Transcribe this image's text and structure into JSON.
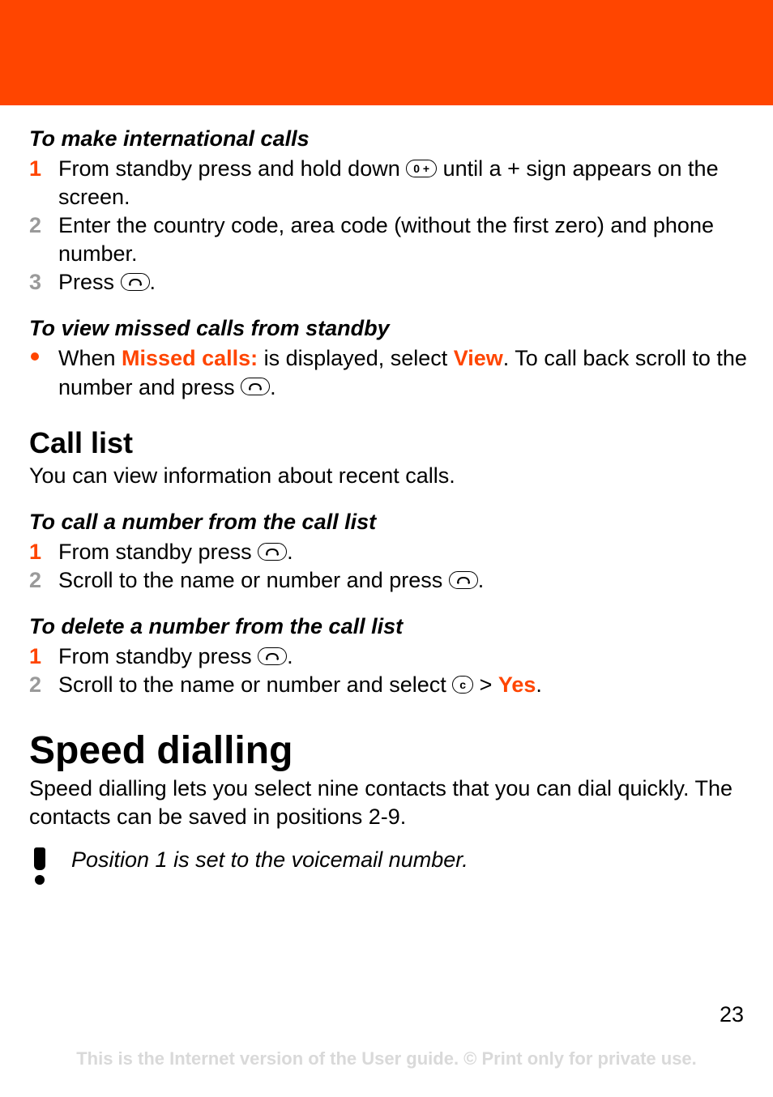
{
  "section1": {
    "heading": "To make international calls",
    "steps": [
      {
        "n": "1",
        "pre": "From standby press and hold down ",
        "post": " until a + sign appears on the screen."
      },
      {
        "n": "2",
        "text": "Enter the country code, area code (without the first zero) and phone number."
      },
      {
        "n": "3",
        "pre": "Press ",
        "post": "."
      }
    ]
  },
  "section2": {
    "heading": "To view missed calls from standby",
    "bullet": {
      "pre": "When ",
      "hl1": "Missed calls:",
      "mid": " is displayed, select ",
      "hl2": "View",
      "post1": ". To call back scroll to the number and press ",
      "post2": "."
    }
  },
  "call_list": {
    "title": "Call list",
    "desc": "You can view information about recent calls."
  },
  "section3": {
    "heading": "To call a number from the call list",
    "steps": [
      {
        "n": "1",
        "pre": "From standby press ",
        "post": "."
      },
      {
        "n": "2",
        "pre": "Scroll to the name or number and press ",
        "post": "."
      }
    ]
  },
  "section4": {
    "heading": "To delete a number from the call list",
    "steps": {
      "s1": {
        "n": "1",
        "pre": "From standby press ",
        "post": "."
      },
      "s2": {
        "n": "2",
        "pre": "Scroll to the name or number and select ",
        "gt": " > ",
        "hl": "Yes",
        "post": "."
      }
    }
  },
  "speed": {
    "title": "Speed dialling",
    "desc": "Speed dialling lets you select nine contacts that you can dial quickly. The contacts can be saved in positions 2-9.",
    "note": "Position 1 is set to the voicemail number."
  },
  "key_labels": {
    "zero_plus": "0 +",
    "c": "c"
  },
  "page_number": "23",
  "footer": "This is the Internet version of the User guide. © Print only for private use."
}
